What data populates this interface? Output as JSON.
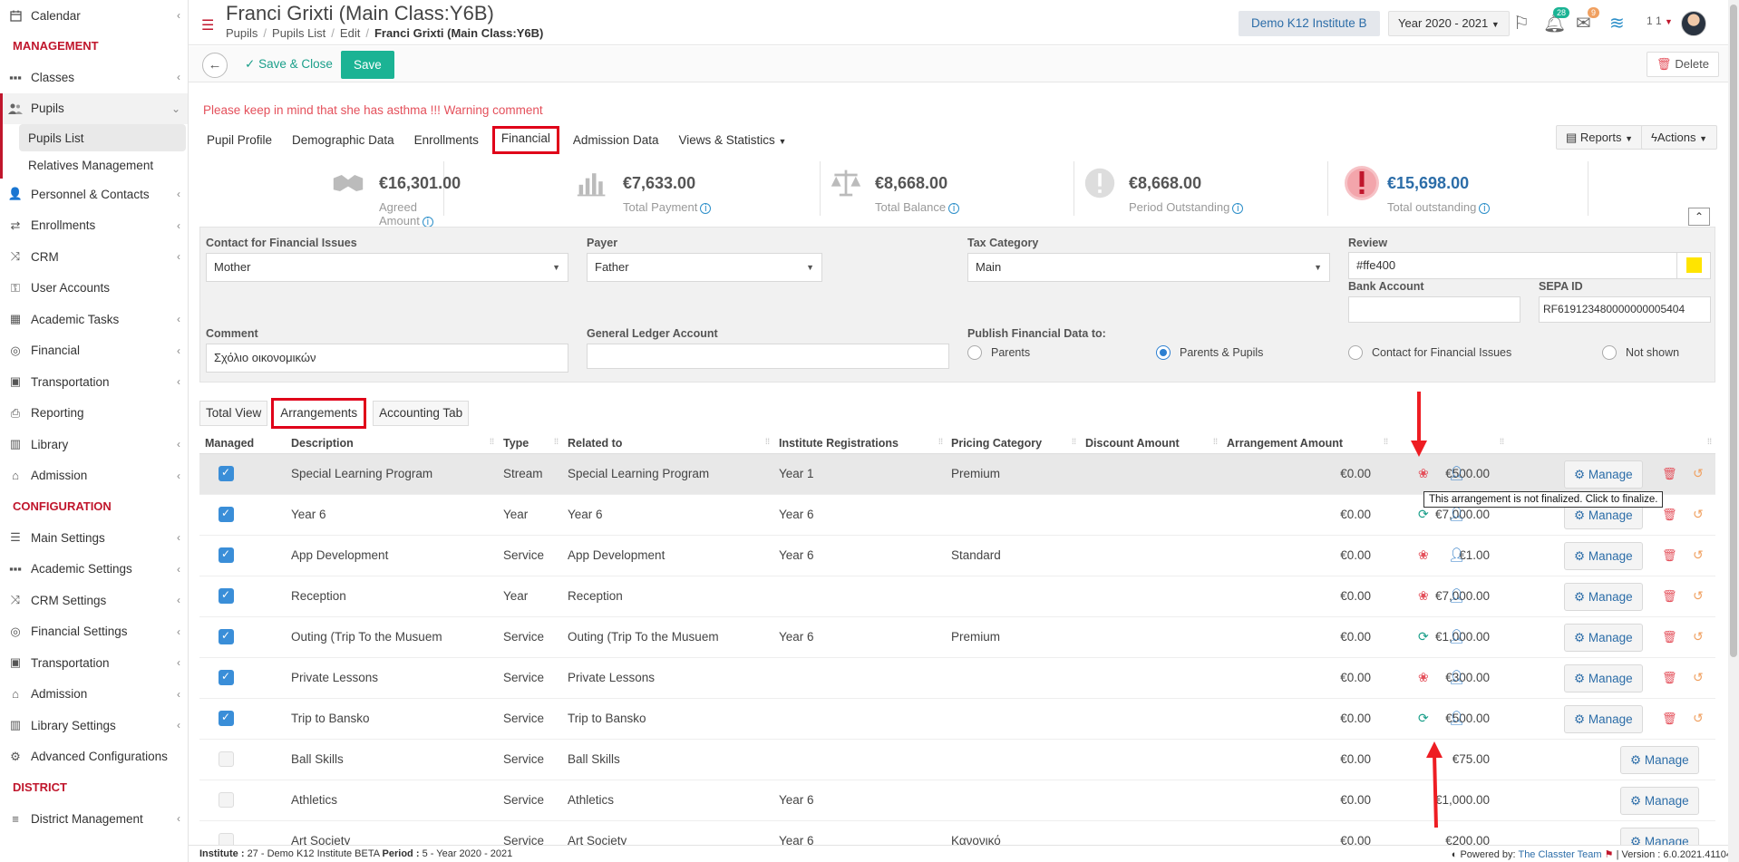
{
  "sidebar": {
    "top_item": {
      "label": "Calendar",
      "icon": "calendar-icon"
    },
    "section_management": "MANAGEMENT",
    "management": [
      {
        "label": "Classes",
        "icon": "classes-icon"
      },
      {
        "label": "Pupils",
        "icon": "users-icon"
      }
    ],
    "pupils_sub": [
      "Pupils List",
      "Relatives Management"
    ],
    "management_rest": [
      {
        "label": "Personnel & Contacts",
        "icon": "personnel-icon"
      },
      {
        "label": "Enrollments",
        "icon": "exchange-icon"
      },
      {
        "label": "CRM",
        "icon": "crm-icon"
      },
      {
        "label": "User Accounts",
        "icon": "key-icon"
      },
      {
        "label": "Academic Tasks",
        "icon": "grid-icon"
      },
      {
        "label": "Financial",
        "icon": "coins-icon"
      },
      {
        "label": "Transportation",
        "icon": "bus-icon"
      },
      {
        "label": "Reporting",
        "icon": "print-icon"
      },
      {
        "label": "Library",
        "icon": "library-icon"
      },
      {
        "label": "Admission",
        "icon": "bank-icon"
      }
    ],
    "section_configuration": "CONFIGURATION",
    "configuration": [
      {
        "label": "Main Settings",
        "icon": "sliders-icon"
      },
      {
        "label": "Academic Settings",
        "icon": "classes-icon"
      },
      {
        "label": "CRM Settings",
        "icon": "crm-icon"
      },
      {
        "label": "Financial Settings",
        "icon": "coins-icon"
      },
      {
        "label": "Transportation",
        "icon": "bus-icon"
      },
      {
        "label": "Admission",
        "icon": "bank-icon"
      },
      {
        "label": "Library Settings",
        "icon": "library-icon"
      },
      {
        "label": "Advanced Configurations",
        "icon": "gears-icon"
      }
    ],
    "section_district": "DISTRICT",
    "district": [
      {
        "label": "District Management",
        "icon": "menu-icon"
      }
    ]
  },
  "header": {
    "title": "Franci Grixti (Main Class:Y6B)",
    "breadcrumb": [
      "Pupils",
      "Pupils List",
      "Edit",
      "Franci Grixti (Main Class:Y6B)"
    ],
    "institute": "Demo K12 Institute B",
    "year": "Year 2020 - 2021",
    "notif_count": "28",
    "mail_count": "9",
    "user_counter": "1 1"
  },
  "toolbar": {
    "save_close": "Save & Close",
    "save": "Save",
    "delete": "Delete"
  },
  "warning": "Please keep in mind that she has asthma !!! Warning comment",
  "tabs": [
    "Pupil Profile",
    "Demographic Data",
    "Enrollments",
    "Financial",
    "Admission Data",
    "Views & Statistics"
  ],
  "reports": "Reports",
  "actions": "Actions",
  "stats": [
    {
      "amount": "€16,301.00",
      "label": "Agreed Amount"
    },
    {
      "amount": "€7,633.00",
      "label": "Total Payment"
    },
    {
      "amount": "€8,668.00",
      "label": "Total Balance"
    },
    {
      "amount": "€8,668.00",
      "label": "Period Outstanding"
    },
    {
      "amount": "€15,698.00",
      "label": "Total outstanding"
    }
  ],
  "form": {
    "contact_label": "Contact for Financial Issues",
    "contact_value": "Mother",
    "payer_label": "Payer",
    "payer_value": "Father",
    "tax_label": "Tax Category",
    "tax_value": "Main",
    "review_label": "Review",
    "review_value": "#ffe400",
    "review_color": "#ffe400",
    "bank_label": "Bank Account",
    "bank_value": "",
    "sepa_label": "SEPA ID",
    "sepa_value": "RF619123480000000005404",
    "comment_label": "Comment",
    "comment_value": "Σχόλιο οικονομικών",
    "ledger_label": "General Ledger Account",
    "ledger_value": "",
    "publish_label": "Publish Financial Data to:",
    "publish_options": [
      "Parents",
      "Parents & Pupils",
      "Contact for Financial Issues",
      "Not shown"
    ],
    "publish_selected": "Parents & Pupils"
  },
  "subtabs": [
    "Total View",
    "Arrangements",
    "Accounting Tab"
  ],
  "table": {
    "headers": [
      "Managed",
      "Description",
      "Type",
      "Related to",
      "Institute Registrations",
      "Pricing Category",
      "Discount Amount",
      "Arrangement Amount"
    ],
    "rows": [
      {
        "managed": true,
        "desc": "Special Learning Program",
        "type": "Stream",
        "related": "Special Learning Program",
        "reg": "Year 1",
        "pricing": "Premium",
        "discount": "€0.00",
        "amount": "€500.00",
        "finalized": false
      },
      {
        "managed": true,
        "desc": "Year 6",
        "type": "Year",
        "related": "Year 6",
        "reg": "Year 6",
        "pricing": "",
        "discount": "€0.00",
        "amount": "€7,000.00",
        "finalized": true
      },
      {
        "managed": true,
        "desc": "App Development",
        "type": "Service",
        "related": "App Development",
        "reg": "Year 6",
        "pricing": "Standard",
        "discount": "€0.00",
        "amount": "€1.00",
        "finalized": false
      },
      {
        "managed": true,
        "desc": "Reception",
        "type": "Year",
        "related": "Reception",
        "reg": "",
        "pricing": "",
        "discount": "€0.00",
        "amount": "€7,000.00",
        "finalized": false
      },
      {
        "managed": true,
        "desc": "Outing (Trip To the Musuem",
        "type": "Service",
        "related": "Outing (Trip To the Musuem",
        "reg": "Year 6",
        "pricing": "Premium",
        "discount": "€0.00",
        "amount": "€1,000.00",
        "finalized": true
      },
      {
        "managed": true,
        "desc": "Private Lessons",
        "type": "Service",
        "related": "Private Lessons",
        "reg": "",
        "pricing": "",
        "discount": "€0.00",
        "amount": "€300.00",
        "finalized": false
      },
      {
        "managed": true,
        "desc": "Trip to Bansko",
        "type": "Service",
        "related": "Trip to Bansko",
        "reg": "",
        "pricing": "",
        "discount": "€0.00",
        "amount": "€500.00",
        "finalized": true
      },
      {
        "managed": false,
        "desc": "Ball Skills",
        "type": "Service",
        "related": "Ball Skills",
        "reg": "",
        "pricing": "",
        "discount": "€0.00",
        "amount": "€75.00",
        "finalized": null
      },
      {
        "managed": false,
        "desc": "Athletics",
        "type": "Service",
        "related": "Athletics",
        "reg": "Year 6",
        "pricing": "",
        "discount": "€0.00",
        "amount": "€1,000.00",
        "finalized": null
      },
      {
        "managed": false,
        "desc": "Art Society",
        "type": "Service",
        "related": "Art Society",
        "reg": "Year 6",
        "pricing": "Κανονικό",
        "discount": "€0.00",
        "amount": "€200.00",
        "finalized": null
      }
    ],
    "manage_label": "Manage"
  },
  "tooltip": "This arrangement is not finalized. Click to finalize.",
  "footer": {
    "left_prefix": "Institute :",
    "institute": "27 - Demo K12 Institute BETA",
    "period_label": "Period :",
    "period": "5 - Year 2020 - 2021",
    "powered": "Powered by:",
    "team": "The Classter Team",
    "version": "| Version : 6.0.2021.41104"
  },
  "colors": {
    "accent": "#c0162c",
    "save": "#1bb394",
    "link": "#2c6da8",
    "highlight_box": "#e00019"
  }
}
